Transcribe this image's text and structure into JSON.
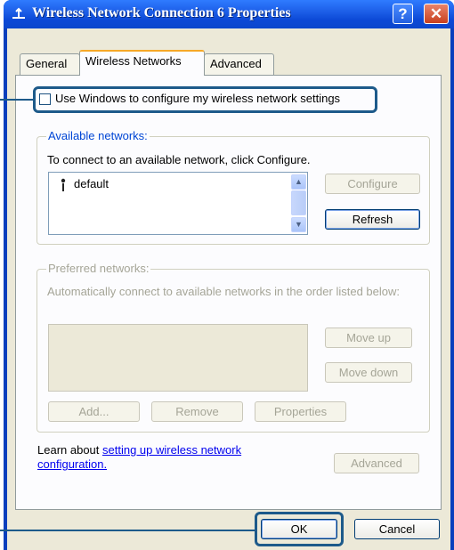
{
  "window": {
    "title": "Wireless Network Connection 6 Properties",
    "help_glyph": "?",
    "close_glyph": "✕"
  },
  "tabs": [
    {
      "label": "General",
      "active": false
    },
    {
      "label": "Wireless Networks",
      "active": true
    },
    {
      "label": "Advanced",
      "active": false
    }
  ],
  "use_windows_checkbox": {
    "label": "Use Windows to configure my wireless network settings",
    "checked": false
  },
  "available": {
    "title": "Available networks:",
    "instruction": "To connect to an available network, click Configure.",
    "networks": [
      {
        "name": "default",
        "icon": "antenna-icon"
      }
    ],
    "configure_label": "Configure",
    "refresh_label": "Refresh"
  },
  "preferred": {
    "title": "Preferred networks:",
    "instruction": "Automatically connect to available networks in the order listed below:",
    "move_up_label": "Move up",
    "move_down_label": "Move down",
    "add_label": "Add...",
    "remove_label": "Remove",
    "properties_label": "Properties"
  },
  "learn": {
    "prefix": "Learn about ",
    "link1": "setting up wireless network",
    "link2": "configuration."
  },
  "advanced_label": "Advanced",
  "ok_label": "OK",
  "cancel_label": "Cancel",
  "colors": {
    "title_bar": "#0c49d6",
    "callout": "#1d5a8a",
    "tab_highlight": "#f6a827"
  }
}
